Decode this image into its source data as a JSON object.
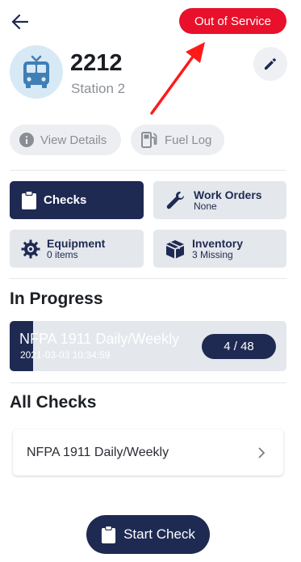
{
  "header": {
    "status_label": "Out of Service",
    "unit_number": "2212",
    "station": "Station 2"
  },
  "chips": {
    "details_label": "View Details",
    "fuel_label": "Fuel Log"
  },
  "tiles": [
    {
      "title": "Checks",
      "subtitle": ""
    },
    {
      "title": "Work Orders",
      "subtitle": "None"
    },
    {
      "title": "Equipment",
      "subtitle": "0 items"
    },
    {
      "title": "Inventory",
      "subtitle": "3 Missing"
    }
  ],
  "in_progress": {
    "section_title": "In Progress",
    "check_name": "NFPA 1911 Daily/Weekly",
    "timestamp": "2021-03-03 10:34:59",
    "progress_text": "4 / 48",
    "progress_fraction": 0.0833
  },
  "all_checks": {
    "section_title": "All Checks",
    "items": [
      {
        "label": "NFPA 1911 Daily/Weekly"
      }
    ]
  },
  "footer": {
    "start_label": "Start Check"
  },
  "colors": {
    "status_red": "#e8102a",
    "navy": "#1e2a52",
    "annotation_red": "#ff1a1a"
  }
}
